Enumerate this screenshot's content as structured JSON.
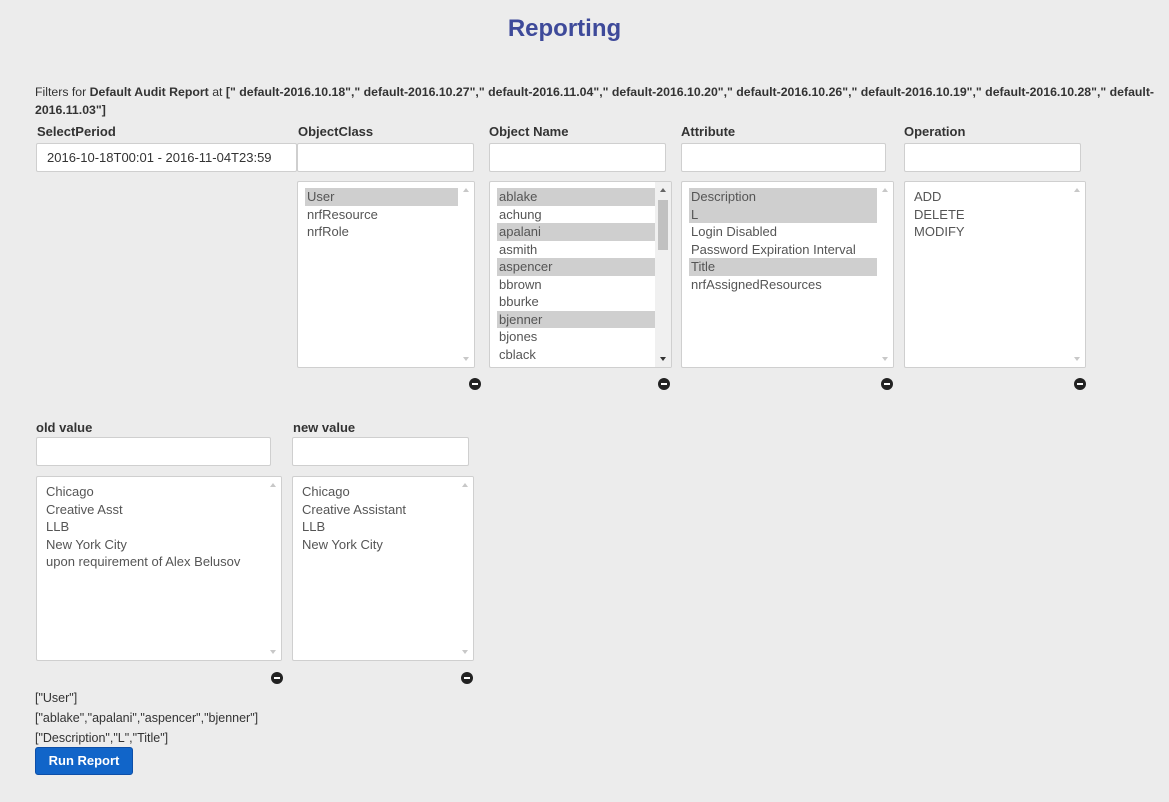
{
  "page": {
    "title": "Reporting"
  },
  "filters": {
    "prefix": "Filters for",
    "report_name": "Default Audit Report",
    "at": "at",
    "datasets": "[\" default-2016.10.18\",\" default-2016.10.27\",\" default-2016.11.04\",\" default-2016.10.20\",\" default-2016.10.26\",\" default-2016.10.19\",\" default-2016.10.28\",\" default-2016.11.03\"]"
  },
  "select_period": {
    "label": "SelectPeriod",
    "value": "2016-10-18T00:01 - 2016-11-04T23:59"
  },
  "object_class": {
    "label": "ObjectClass",
    "filter_value": "",
    "items": [
      {
        "label": "User",
        "selected": true
      },
      {
        "label": "nrfResource",
        "selected": false
      },
      {
        "label": "nrfRole",
        "selected": false
      }
    ]
  },
  "object_name": {
    "label": "Object Name",
    "filter_value": "",
    "items": [
      {
        "label": "ablake",
        "selected": true
      },
      {
        "label": "achung",
        "selected": false
      },
      {
        "label": "apalani",
        "selected": true
      },
      {
        "label": "asmith",
        "selected": false
      },
      {
        "label": "aspencer",
        "selected": true
      },
      {
        "label": "bbrown",
        "selected": false
      },
      {
        "label": "bburke",
        "selected": false
      },
      {
        "label": "bjenner",
        "selected": true
      },
      {
        "label": "bjones",
        "selected": false
      },
      {
        "label": "cblack",
        "selected": false
      }
    ]
  },
  "attribute": {
    "label": "Attribute",
    "filter_value": "",
    "items": [
      {
        "label": "Description",
        "selected": true
      },
      {
        "label": "L",
        "selected": true
      },
      {
        "label": "Login Disabled",
        "selected": false
      },
      {
        "label": "Password Expiration Interval",
        "selected": false
      },
      {
        "label": "Title",
        "selected": true
      },
      {
        "label": "nrfAssignedResources",
        "selected": false
      }
    ]
  },
  "operation": {
    "label": "Operation",
    "filter_value": "",
    "items": [
      {
        "label": "ADD",
        "selected": false
      },
      {
        "label": "DELETE",
        "selected": false
      },
      {
        "label": "MODIFY",
        "selected": false
      }
    ]
  },
  "old_value": {
    "label": "old value",
    "filter_value": "",
    "items": [
      {
        "label": "Chicago",
        "selected": false
      },
      {
        "label": "Creative Asst",
        "selected": false
      },
      {
        "label": "LLB",
        "selected": false
      },
      {
        "label": "New York City",
        "selected": false
      },
      {
        "label": "upon requirement of Alex Belusov",
        "selected": false
      }
    ]
  },
  "new_value": {
    "label": "new value",
    "filter_value": "",
    "items": [
      {
        "label": "Chicago",
        "selected": false
      },
      {
        "label": "Creative Assistant",
        "selected": false
      },
      {
        "label": "LLB",
        "selected": false
      },
      {
        "label": "New York City",
        "selected": false
      }
    ]
  },
  "selection_summary": {
    "object_class": "[\"User\"]",
    "object_name": "[\"ablake\",\"apalani\",\"aspencer\",\"bjenner\"]",
    "attribute": "[\"Description\",\"L\",\"Title\"]"
  },
  "run_button": {
    "label": "Run Report"
  },
  "colors": {
    "title": "#3e4a9a",
    "button": "#1165c9",
    "selected_row": "#cfcfcf"
  },
  "icons": {
    "clear": "minus-circle-icon"
  }
}
